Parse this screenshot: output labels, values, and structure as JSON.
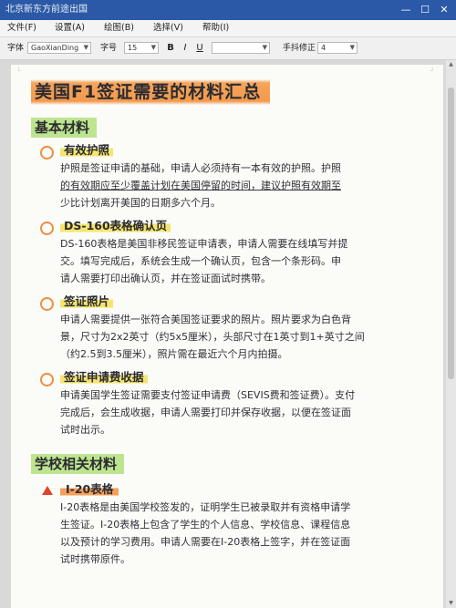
{
  "window": {
    "title": "北京新东方前途出国",
    "minimize_glyph": "—",
    "maximize_glyph": "☐",
    "close_glyph": "✕"
  },
  "menu": [
    "文件(F)",
    "设置(A)",
    "绘图(B)",
    "选择(V)",
    "帮助(I)"
  ],
  "toolbar": {
    "font_label": "字体",
    "font_value": "GaoXianDing",
    "size_label": "字号",
    "size_value": "15",
    "bold": "B",
    "italic": "I",
    "underline": "U",
    "extra_value": "",
    "correction_label": "手抖修正",
    "correction_value": "4"
  },
  "document": {
    "title": "美国F1签证需要的材料汇总",
    "section1": "基本材料",
    "items": [
      {
        "heading": "有效护照",
        "lines": [
          "护照是签证申请的基础，申请人必须持有一本有效的护照。护照",
          "的有效期应至少覆盖计划在美国停留的时间，建议护照有效期至",
          "少比计划离开美国的日期多六个月。"
        ]
      },
      {
        "heading": "DS-160表格确认页",
        "lines": [
          "DS-160表格是美国非移民签证申请表，申请人需要在线填写并提",
          "交。填写完成后，系统会生成一个确认页，包含一个条形码。申",
          "请人需要打印出确认页，并在签证面试时携带。"
        ]
      },
      {
        "heading": "签证照片",
        "lines": [
          "申请人需要提供一张符合美国签证要求的照片。照片要求为白色背",
          "景，尺寸为2x2英寸（约5x5厘米），头部尺寸在1英寸到1+英寸之间",
          "（约2.5到3.5厘米），照片需在最近六个月内拍摄。"
        ]
      },
      {
        "heading": "签证申请费收据",
        "lines": [
          "申请美国学生签证需要支付签证申请费（SEVIS费和签证费）。支付",
          "完成后，会生成收据，申请人需要打印并保存收据，以便在签证面",
          "试时出示。"
        ]
      }
    ],
    "section2": "学校相关材料",
    "i20": {
      "heading": "I-20表格",
      "lines": [
        "I-20表格是由美国学校签发的，证明学生已被录取并有资格申请学",
        "生签证。I-20表格上包含了学生的个人信息、学校信息、课程信息",
        "以及预计的学习费用。申请人需要在I-20表格上签字，并在签证面",
        "试时携带原件。"
      ]
    }
  }
}
